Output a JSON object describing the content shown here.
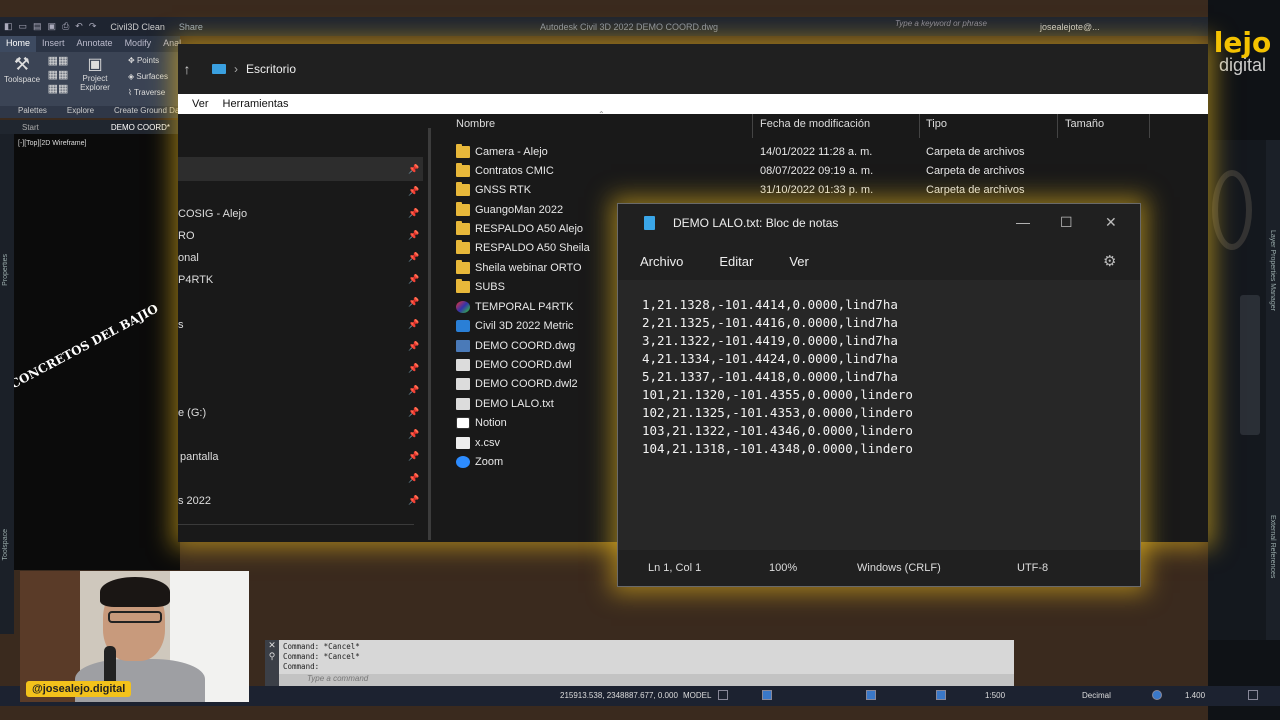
{
  "acad": {
    "workspace": "Civil3D Clean",
    "share": "Share",
    "app_title": "Autodesk Civil 3D 2022   DEMO COORD.dwg",
    "search_placeholder": "Type a keyword or phrase",
    "user": "josealejote@...",
    "ribbon_tabs": [
      "Home",
      "Insert",
      "Annotate",
      "Modify",
      "Anal"
    ],
    "tools": {
      "toolspace": "Toolspace",
      "project_explorer_1": "Project",
      "project_explorer_2": "Explorer",
      "points": "Points",
      "surfaces": "Surfaces",
      "traverse": "Traverse"
    },
    "panels": [
      "Palettes",
      "Explore",
      "Create Ground Da"
    ],
    "doc_tabs": {
      "start": "Start",
      "active": "DEMO COORD*"
    },
    "viewport_label": "[-][Top][2D Wireframe]",
    "drawing_text": "CONCRETOS DEL BAJIO",
    "left_strip": [
      "Properties",
      "Toolspace"
    ],
    "right_strip": [
      "Layer Properties Manager",
      "External References"
    ]
  },
  "brand": {
    "line1": "lejo",
    "line2": "digital"
  },
  "explorer": {
    "address": "Escritorio",
    "menu": [
      "Ver",
      "Herramientas"
    ],
    "nav_items": [
      "COSIG - Alejo",
      "RO",
      "onal",
      "P4RTK",
      "s",
      "e (G:)",
      "pantalla",
      "s 2022"
    ],
    "columns": [
      "Nombre",
      "Fecha de modificación",
      "Tipo",
      "Tamaño"
    ],
    "files": [
      {
        "name": "Camera - Alejo",
        "date": "14/01/2022 11:28 a. m.",
        "type": "Carpeta de archivos",
        "icon": "folder"
      },
      {
        "name": "Contratos CMIC",
        "date": "08/07/2022 09:19 a. m.",
        "type": "Carpeta de archivos",
        "icon": "folder"
      },
      {
        "name": "GNSS RTK",
        "date": "31/10/2022 01:33 p. m.",
        "type": "Carpeta de archivos",
        "icon": "folder"
      },
      {
        "name": "GuangoMan 2022",
        "date": "",
        "type": "",
        "icon": "folder"
      },
      {
        "name": "RESPALDO A50 Alejo",
        "date": "",
        "type": "",
        "icon": "folder"
      },
      {
        "name": "RESPALDO A50 Sheila",
        "date": "",
        "type": "",
        "icon": "folder"
      },
      {
        "name": "Sheila webinar ORTO",
        "date": "",
        "type": "",
        "icon": "folder"
      },
      {
        "name": "SUBS",
        "date": "",
        "type": "",
        "icon": "folder"
      },
      {
        "name": "TEMPORAL P4RTK",
        "date": "",
        "type": "",
        "icon": "p4"
      },
      {
        "name": "Civil 3D 2022 Metric",
        "date": "",
        "type": "",
        "icon": "app"
      },
      {
        "name": "DEMO COORD.dwg",
        "date": "",
        "type": "",
        "icon": "dwg"
      },
      {
        "name": "DEMO COORD.dwl",
        "date": "",
        "type": "",
        "icon": "doc"
      },
      {
        "name": "DEMO COORD.dwl2",
        "date": "",
        "type": "",
        "icon": "doc"
      },
      {
        "name": "DEMO LALO.txt",
        "date": "",
        "type": "",
        "icon": "doc"
      },
      {
        "name": "Notion",
        "date": "",
        "type": "",
        "icon": "notion"
      },
      {
        "name": "x.csv",
        "date": "",
        "type": "",
        "icon": "csv"
      },
      {
        "name": "Zoom",
        "date": "",
        "type": "",
        "icon": "zoom"
      }
    ]
  },
  "notepad": {
    "title": "DEMO LALO.txt: Bloc de notas",
    "menu": [
      "Archivo",
      "Editar",
      "Ver"
    ],
    "lines": [
      "1,21.1328,-101.4414,0.0000,lind7ha",
      "2,21.1325,-101.4416,0.0000,lind7ha",
      "3,21.1322,-101.4419,0.0000,lind7ha",
      "4,21.1334,-101.4424,0.0000,lind7ha",
      "5,21.1337,-101.4418,0.0000,lind7ha",
      "101,21.1320,-101.4355,0.0000,lindero",
      "102,21.1325,-101.4353,0.0000,lindero",
      "103,21.1322,-101.4346,0.0000,lindero",
      "104,21.1318,-101.4348,0.0000,lindero"
    ],
    "status": {
      "pos": "Ln 1, Col 1",
      "zoom": "100%",
      "eol": "Windows (CRLF)",
      "enc": "UTF-8"
    }
  },
  "command": {
    "history": [
      "Command: *Cancel*",
      "Command: *Cancel*",
      "Command:"
    ],
    "placeholder": "Type a command"
  },
  "status_bar": {
    "coords": "215913.538, 2348887.677, 0.000",
    "model": "MODEL",
    "scale": "1:500",
    "units": "Decimal",
    "value": "1.400"
  },
  "webcam": {
    "handle": "@josealejo.digital"
  },
  "colors": {
    "glow": "#f0be1e",
    "folder": "#e8b83a",
    "accent": "#3aa6e8"
  }
}
